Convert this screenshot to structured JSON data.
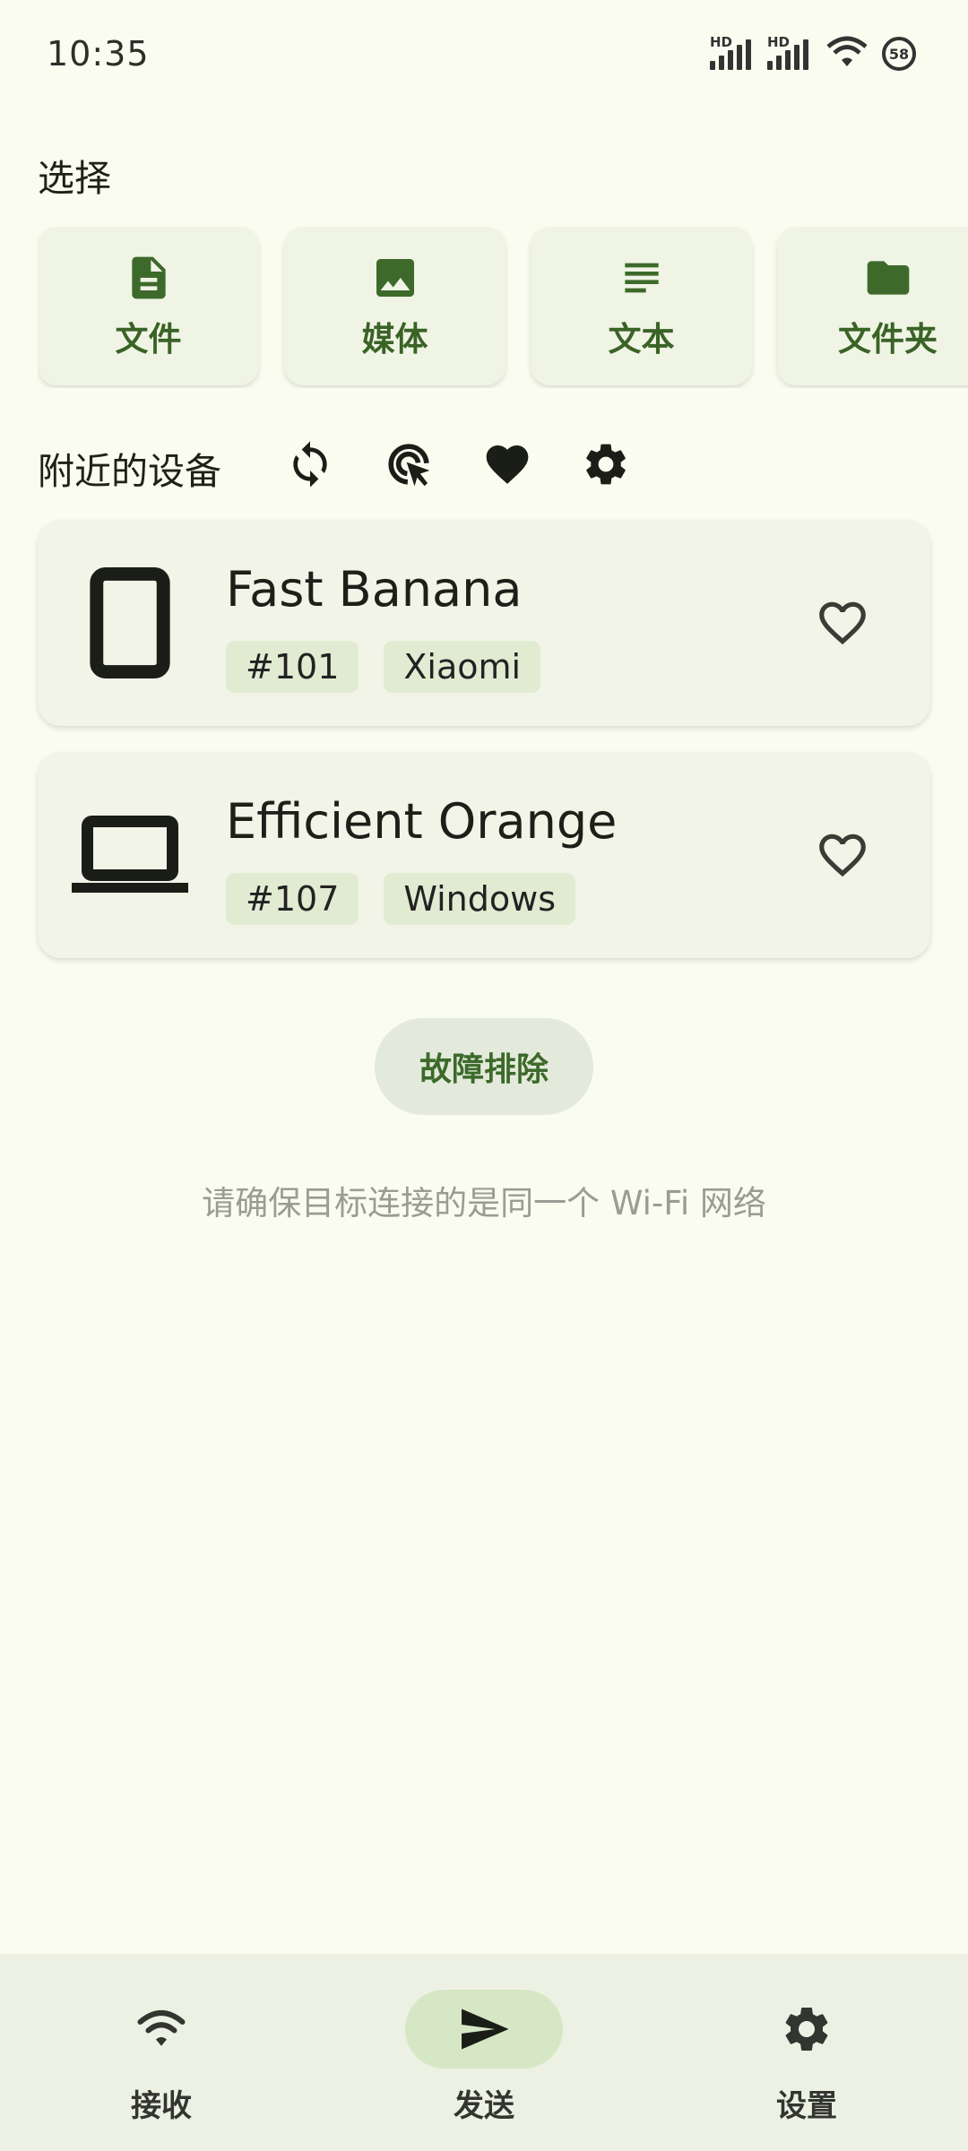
{
  "status_bar": {
    "time": "10:35",
    "signal1_label": "HD",
    "signal2_label": "HD",
    "battery": "58"
  },
  "select": {
    "title": "选择",
    "items": [
      {
        "label": "文件",
        "icon": "file-icon"
      },
      {
        "label": "媒体",
        "icon": "image-icon"
      },
      {
        "label": "文本",
        "icon": "text-icon"
      },
      {
        "label": "文件夹",
        "icon": "folder-icon"
      }
    ]
  },
  "nearby": {
    "title": "附近的设备",
    "tools": [
      "refresh-icon",
      "target-cursor-icon",
      "favorites-icon",
      "settings-icon"
    ]
  },
  "devices": [
    {
      "name": "Fast Banana",
      "id": "#101",
      "type": "Xiaomi",
      "icon": "phone-icon"
    },
    {
      "name": "Efficient Orange",
      "id": "#107",
      "type": "Windows",
      "icon": "laptop-icon"
    }
  ],
  "troubleshoot_label": "故障排除",
  "hint": "请确保目标连接的是同一个 Wi-Fi 网络",
  "bottom_nav": {
    "items": [
      {
        "label": "接收",
        "icon": "wifi-icon"
      },
      {
        "label": "发送",
        "icon": "send-icon"
      },
      {
        "label": "设置",
        "icon": "gear-icon"
      }
    ],
    "active_index": 1
  },
  "colors": {
    "background": "#f9fcef",
    "accent": "#3a6326",
    "card": "#f1f4e7"
  }
}
